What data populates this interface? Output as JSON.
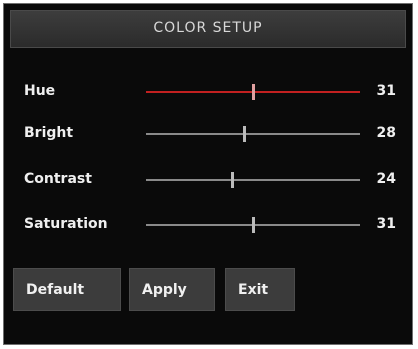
{
  "menu": {
    "title": "COLOR SETUP"
  },
  "settings": [
    {
      "label": "Hue",
      "value": "31",
      "level": 0.5,
      "active": true
    },
    {
      "label": "Bright",
      "value": "28",
      "level": 0.46,
      "active": false
    },
    {
      "label": "Contrast",
      "value": "24",
      "level": 0.4,
      "active": false
    },
    {
      "label": "Saturation",
      "value": "31",
      "level": 0.5,
      "active": false
    }
  ],
  "buttons": {
    "default_label": "Default",
    "apply_label": "Apply",
    "exit_label": "Exit"
  },
  "colors": {
    "active_track": "#c22020",
    "track": "#8a8a8a",
    "background": "#0a0a0a"
  }
}
